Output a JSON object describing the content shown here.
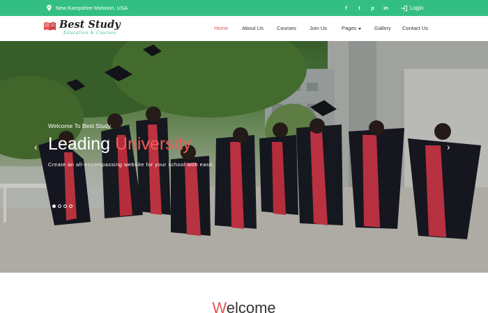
{
  "topbar": {
    "location": "New Kampshire Mshinon, USA",
    "socials": [
      {
        "icon": "facebook-icon",
        "glyph": "f"
      },
      {
        "icon": "twitter-icon",
        "glyph": "t"
      },
      {
        "icon": "pinterest-icon",
        "glyph": "p"
      },
      {
        "icon": "linkedin-icon",
        "glyph": "in"
      }
    ],
    "login_label": "Login",
    "bg_color": "#33bf84"
  },
  "logo": {
    "title": "Best Study",
    "subtitle": "Education & Courses"
  },
  "nav": {
    "home": "Home",
    "about": "About Us",
    "courses": "Courses",
    "join": "Join Us",
    "pages": "Pages",
    "gallery": "Gallery",
    "contact": "Contact Us",
    "active_color": "#e25555"
  },
  "hero": {
    "eyebrow": "Welcome To Best Study",
    "title_main": "Leading",
    "title_accent": "University",
    "description": "Create an all-encompassing website for your school with ease.",
    "accent_color": "#f05a5a",
    "slides": 4,
    "active_slide": 1
  },
  "welcome": {
    "first_letter": "W",
    "rest": "elcome"
  }
}
